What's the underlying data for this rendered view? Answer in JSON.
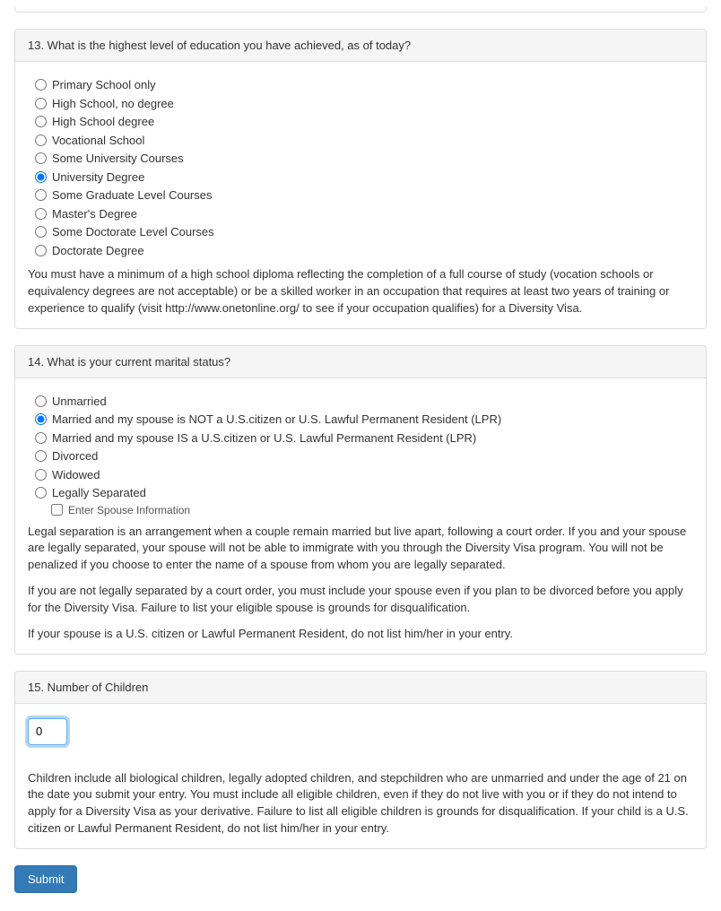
{
  "q13": {
    "title": "13. What is the highest level of education you have achieved, as of today?",
    "options": [
      "Primary School only",
      "High School, no degree",
      "High School degree",
      "Vocational School",
      "Some University Courses",
      "University Degree",
      "Some Graduate Level Courses",
      "Master's Degree",
      "Some Doctorate Level Courses",
      "Doctorate Degree"
    ],
    "selected_index": 5,
    "help": "You must have a minimum of a high school diploma reflecting the completion of a full course of study (vocation schools or equivalency degrees are not acceptable) or be a skilled worker in an occupation that requires at least two years of training or experience to qualify (visit http://www.onetonline.org/ to see if your occupation qualifies) for a Diversity Visa."
  },
  "q14": {
    "title": "14. What is your current marital status?",
    "options": [
      "Unmarried",
      "Married and my spouse is NOT a U.S.citizen or U.S. Lawful Permanent Resident (LPR)",
      "Married and my spouse IS a U.S.citizen or U.S. Lawful Permanent Resident (LPR)",
      "Divorced",
      "Widowed",
      "Legally Separated"
    ],
    "selected_index": 1,
    "spouse_checkbox_label": "Enter Spouse Information",
    "spouse_checkbox_checked": false,
    "help1": "Legal separation is an arrangement when a couple remain married but live apart, following a court order. If you and your spouse are legally separated, your spouse will not be able to immigrate with you through the Diversity Visa program. You will not be penalized if you choose to enter the name of a spouse from whom you are legally separated.",
    "help2": "If you are not legally separated by a court order, you must include your spouse even if you plan to be divorced before you apply for the Diversity Visa. Failure to list your eligible spouse is grounds for disqualification.",
    "help3": "If your spouse is a U.S. citizen or Lawful Permanent Resident, do not list him/her in your entry."
  },
  "q15": {
    "title": "15. Number of Children",
    "value": "0",
    "help": "Children include all biological children, legally adopted children, and stepchildren who are unmarried and under the age of 21 on the date you submit your entry. You must include all eligible children, even if they do not live with you or if they do not intend to apply for a Diversity Visa as your derivative. Failure to list all eligible children is grounds for disqualification. If your child is a U.S. citizen or Lawful Permanent Resident, do not list him/her in your entry."
  },
  "buttons": {
    "submit": "Submit"
  }
}
